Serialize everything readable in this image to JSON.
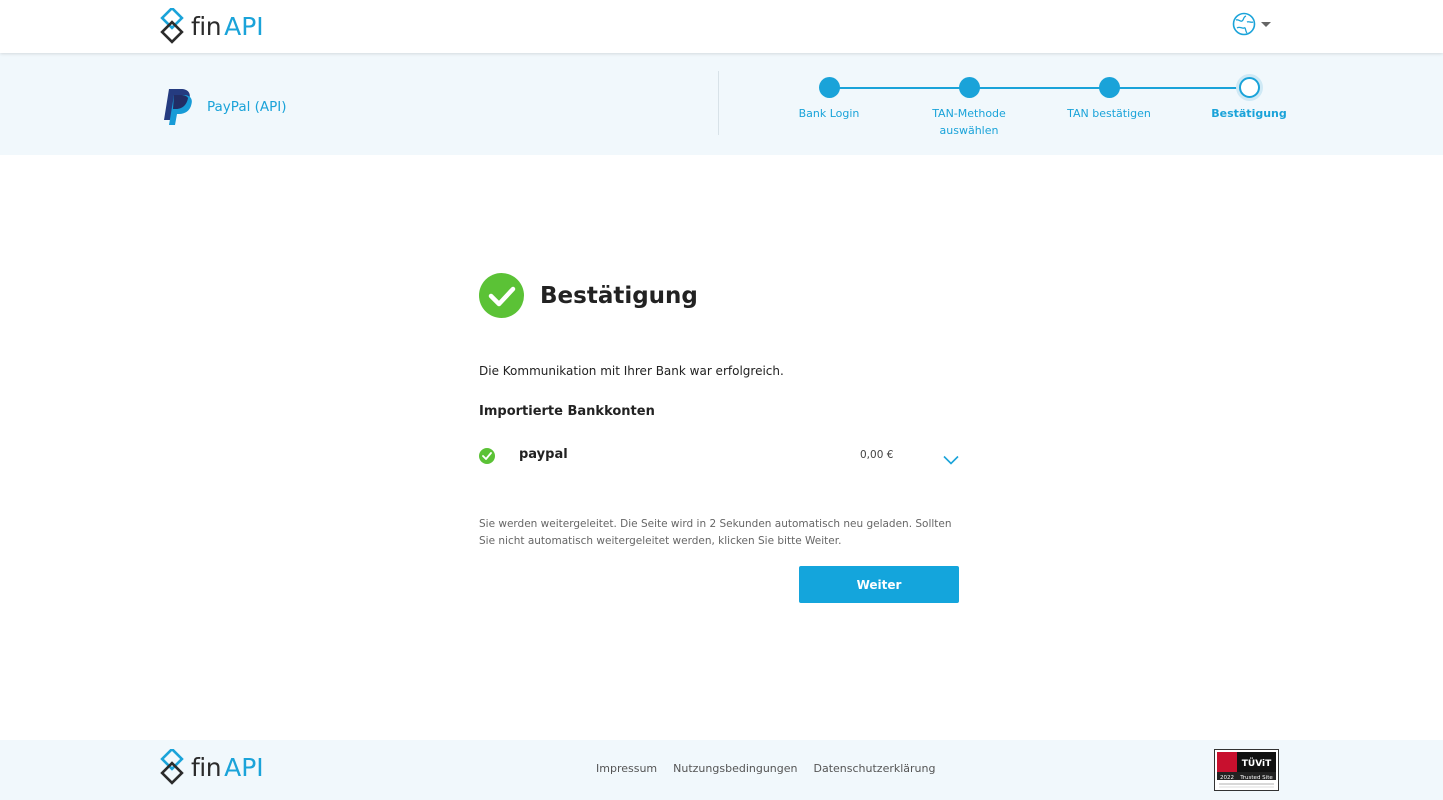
{
  "header": {
    "logo": {
      "fin": "fin",
      "api": "API"
    },
    "language_icon": "globe-icon"
  },
  "bank": {
    "name": "PayPal (API)",
    "logo": "paypal-logo"
  },
  "steps": [
    {
      "label": "Bank Login",
      "state": "done"
    },
    {
      "label": "TAN-Methode auswählen",
      "state": "done"
    },
    {
      "label": "TAN bestätigen",
      "state": "done"
    },
    {
      "label": "Bestätigung",
      "state": "current"
    }
  ],
  "main": {
    "title": "Bestätigung",
    "description": "Die Kommunikation mit Ihrer Bank war erfolgreich.",
    "accounts_heading": "Importierte Bankkonten",
    "accounts": [
      {
        "name": "paypal",
        "amount": "0,00 €"
      }
    ],
    "redirect_text": "Sie werden weitergeleitet. Die Seite wird in 2 Sekunden automatisch neu geladen. Sollten Sie nicht automatisch weitergeleitet werden, klicken Sie bitte Weiter.",
    "button_label": "Weiter"
  },
  "footer": {
    "logo": {
      "fin": "fin",
      "api": "API"
    },
    "links": [
      "Impressum",
      "Nutzungsbedingungen",
      "Datenschutzerklärung"
    ],
    "seal": {
      "brand": "TÜViT",
      "label": "Trusted Site",
      "year": "2022"
    }
  },
  "colors": {
    "accent": "#1aa3d9",
    "success": "#5bc236",
    "band_background": "#f1f8fc"
  }
}
